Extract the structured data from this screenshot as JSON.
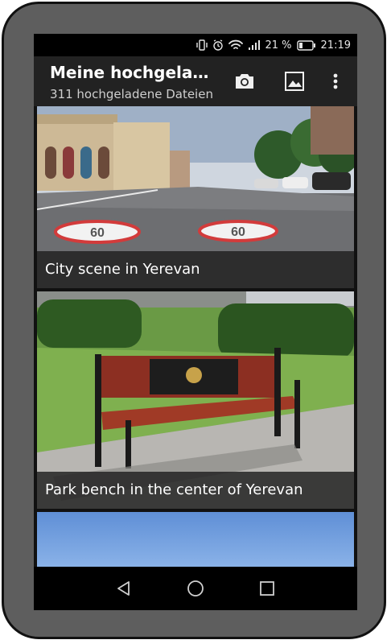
{
  "status_bar": {
    "battery_percent": "21 %",
    "time": "21:19",
    "icons": [
      "vibrate-icon",
      "alarm-icon",
      "wifi-icon",
      "signal-icon",
      "battery-icon"
    ]
  },
  "app_bar": {
    "title": "Meine hochgeladene Dateien",
    "subtitle": "311 hochgeladene Dateien",
    "actions": [
      "camera-icon",
      "gallery-icon",
      "overflow-menu-icon"
    ]
  },
  "feed": {
    "items": [
      {
        "caption": "City scene in Yerevan"
      },
      {
        "caption": "Park bench in the center of Yerevan"
      },
      {
        "caption": ""
      }
    ]
  },
  "nav_bar": {
    "buttons": [
      "back-icon",
      "home-icon",
      "recents-icon"
    ]
  },
  "colors": {
    "frame": "#5e5e5e",
    "app_bar": "#222222",
    "caption_bg": "#1e1e1e",
    "sky": "#6f9fe0"
  }
}
